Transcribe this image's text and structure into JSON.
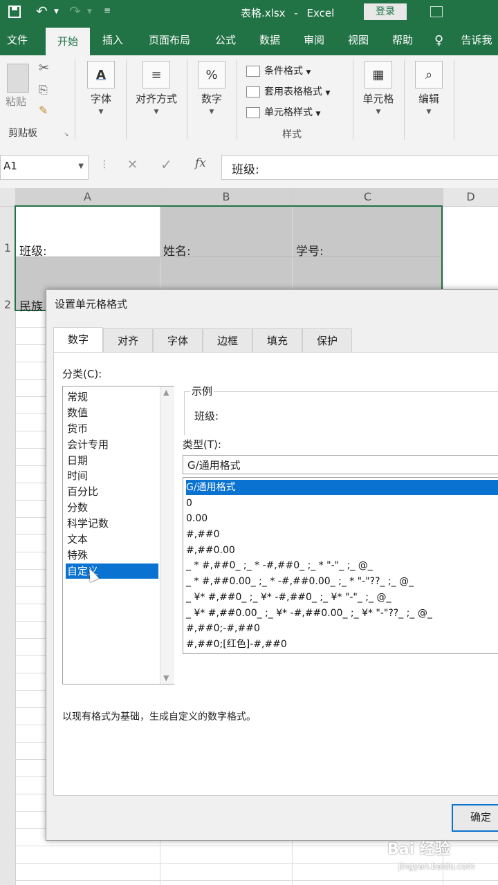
{
  "titlebar": {
    "filename": "表格.xlsx",
    "separator": "-",
    "app": "Excel",
    "login_label": "登录"
  },
  "ribbon_tabs": [
    "文件",
    "开始",
    "插入",
    "页面布局",
    "公式",
    "数据",
    "审阅",
    "视图",
    "帮助",
    "告诉我"
  ],
  "ribbon": {
    "paste_label": "粘贴",
    "clipboard_group": "剪贴板",
    "font_label": "字体",
    "align_label": "对齐方式",
    "number_label": "数字",
    "cond_format": "条件格式",
    "table_format": "套用表格格式",
    "cell_style": "单元格样式",
    "style_group": "样式",
    "cells_label": "单元格",
    "edit_label": "编辑"
  },
  "formula_bar": {
    "name_box": "A1",
    "formula": "班级:"
  },
  "sheet": {
    "columns": [
      "A",
      "B",
      "C",
      "D"
    ],
    "row1": [
      "班级:",
      "姓名:",
      "学号:"
    ],
    "row2_a": "民族"
  },
  "dialog": {
    "title": "设置单元格格式",
    "tabs": [
      "数字",
      "对齐",
      "字体",
      "边框",
      "填充",
      "保护"
    ],
    "category_label": "分类(C):",
    "categories": [
      "常规",
      "数值",
      "货币",
      "会计专用",
      "日期",
      "时间",
      "百分比",
      "分数",
      "科学记数",
      "文本",
      "特殊",
      "自定义"
    ],
    "selected_category": "自定义",
    "sample_label": "示例",
    "sample_value": "班级:",
    "type_label": "类型(T):",
    "type_value": "G/通用格式",
    "type_list": [
      "G/通用格式",
      "0",
      "0.00",
      "#,##0",
      "#,##0.00",
      "_ * #,##0_ ;_ * -#,##0_ ;_ * \"-\"_ ;_ @_",
      "_ * #,##0.00_ ;_ * -#,##0.00_ ;_ * \"-\"??_ ;_ @_",
      "_ ¥* #,##0_ ;_ ¥* -#,##0_ ;_ ¥* \"-\"_ ;_ @_",
      "_ ¥* #,##0.00_ ;_ ¥* -#,##0.00_ ;_ ¥* \"-\"??_ ;_ @_",
      "#,##0;-#,##0",
      "#,##0;[红色]-#,##0"
    ],
    "description": "以现有格式为基础，生成自定义的数字格式。",
    "ok_label": "确定"
  },
  "watermark": {
    "text": "Bai 经验",
    "url": "jingyan.baidu.com"
  },
  "colors": {
    "excel_green": "#217346",
    "selection_blue": "#0a72d1"
  }
}
